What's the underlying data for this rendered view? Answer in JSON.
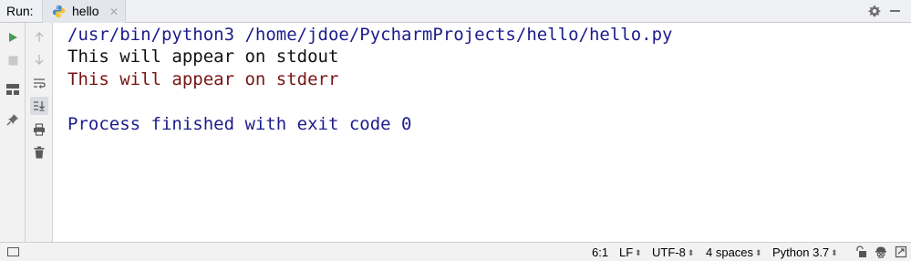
{
  "run_header": {
    "label": "Run:",
    "tab": {
      "label": "hello",
      "icon": "python-file-icon"
    },
    "actions": [
      "gear-icon",
      "minimize-icon"
    ]
  },
  "toolbar_left": [
    "run-icon",
    "stop-icon",
    "layout-icon",
    "pin-icon"
  ],
  "toolbar_right": [
    "up-arrow-icon",
    "down-arrow-icon",
    "soft-wrap-icon",
    "scroll-to-end-icon",
    "print-icon",
    "trash-icon"
  ],
  "console": {
    "command": "/usr/bin/python3 /home/jdoe/PycharmProjects/hello/hello.py",
    "stdout": "This will appear on stdout",
    "stderr": "This will appear on stderr",
    "exit": "Process finished with exit code 0"
  },
  "status_bar": {
    "position": "6:1",
    "line_separator": "LF",
    "encoding": "UTF-8",
    "indent": "4 spaces",
    "interpreter": "Python 3.7",
    "icons": [
      "lock-icon",
      "inspector-icon",
      "notifications-icon"
    ]
  },
  "colors": {
    "command": "#1c1c8c",
    "stdout": "#111111",
    "stderr": "#7a1414",
    "run_green": "#499c54"
  }
}
